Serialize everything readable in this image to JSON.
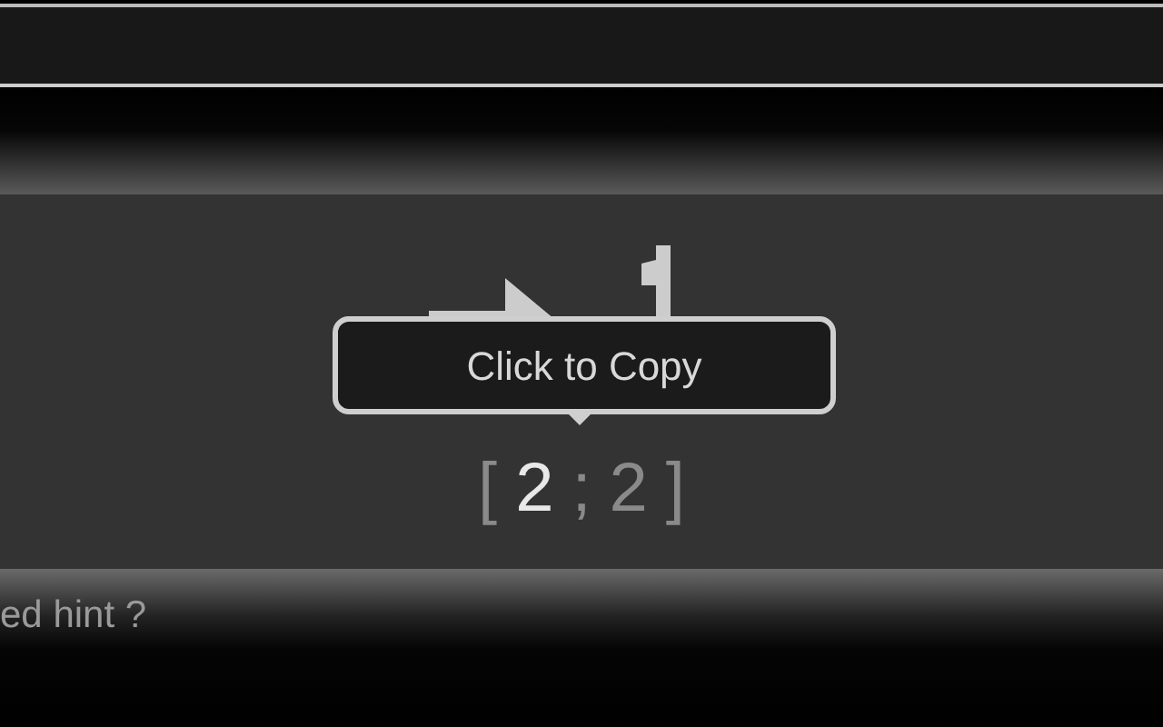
{
  "tooltip": {
    "text": "Click to Copy"
  },
  "coordinates": [
    {
      "text": "[",
      "highlighted": false
    },
    {
      "text": "2",
      "highlighted": true
    },
    {
      "text": ";",
      "highlighted": false
    },
    {
      "text": "2",
      "highlighted": false
    },
    {
      "text": "]",
      "highlighted": false
    }
  ],
  "footer": {
    "text": "ed hint ?"
  }
}
